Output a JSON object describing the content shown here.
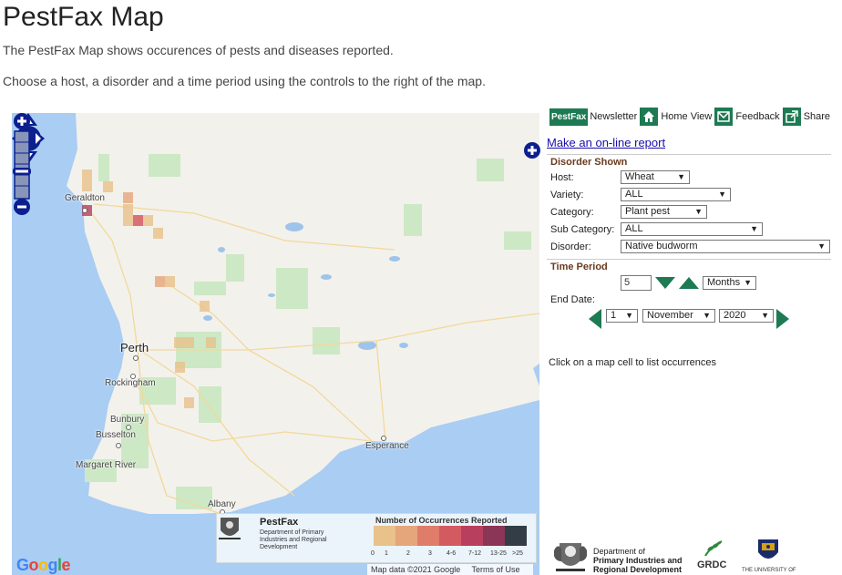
{
  "page": {
    "title": "PestFax Map",
    "intro1": "The PestFax Map shows occurences of pests and diseases reported.",
    "intro2": "Choose a host, a disorder and a time period using the controls to the right of the map."
  },
  "map": {
    "cities": {
      "geraldton": "Geraldton",
      "perth": "Perth",
      "rockingham": "Rockingham",
      "bunbury": "Bunbury",
      "busselton": "Busselton",
      "margaret_river": "Margaret River",
      "albany": "Albany",
      "esperance": "Esperance"
    },
    "google": "Google",
    "footer": {
      "data": "Map data ©2021 Google",
      "terms": "Terms of Use"
    },
    "legend": {
      "brand": "PestFax",
      "dept": "Department of Primary Industries and Regional Development",
      "title": "Number of Occurrences Reported",
      "labels": [
        "0",
        "1",
        "2",
        "3",
        "4-6",
        "7-12",
        "13-25",
        ">25"
      ],
      "colors": [
        "#e9c18a",
        "#e5a67c",
        "#e07c6a",
        "#d45a62",
        "#b83f5e",
        "#8b3557",
        "#323d46"
      ]
    }
  },
  "toolbar": {
    "pestfax": "PestFax",
    "newsletter": "Newsletter",
    "home": "Home View",
    "feedback": "Feedback",
    "share": "Share"
  },
  "report_link": "Make an on-line report",
  "disorder": {
    "title": "Disorder Shown",
    "host_label": "Host:",
    "host": "Wheat",
    "variety_label": "Variety:",
    "variety": "ALL",
    "category_label": "Category:",
    "category": "Plant pest",
    "subcategory_label": "Sub Category:",
    "subcategory": "ALL",
    "disorder_label": "Disorder:",
    "disorder": "Native budworm"
  },
  "time": {
    "title": "Time Period",
    "count": "5",
    "unit": "Months",
    "end_label": "End Date:",
    "day": "1",
    "month": "November",
    "year": "2020"
  },
  "status": "Click on a map cell to list occurrences",
  "footer": {
    "dept_line1": "Department of",
    "dept_line2": "Primary Industries and",
    "dept_line3": "Regional Development",
    "grdc": "GRDC",
    "uwa": "THE UNIVERSITY OF"
  },
  "colors": {
    "accent": "#1d7a52",
    "nav": "#0c1f8f",
    "section_title": "#6b3a1f"
  }
}
